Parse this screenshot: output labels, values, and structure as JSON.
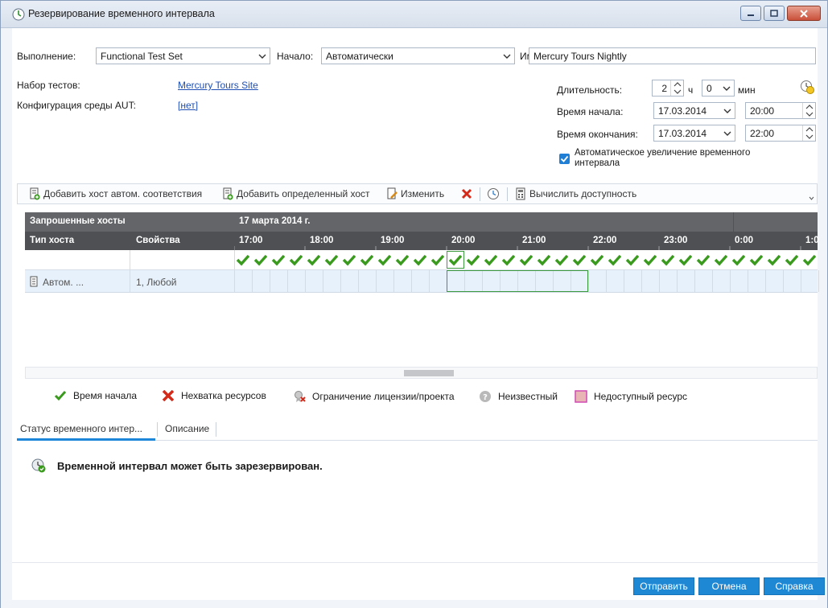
{
  "window": {
    "title": "Резервирование временного интервала"
  },
  "form": {
    "execution_label": "Выполнение:",
    "execution_value": "Functional Test Set",
    "start_label": "Начало:",
    "start_value": "Автоматически",
    "name_label": "Имя:",
    "name_value": "Mercury Tours Nightly",
    "testset_label": "Набор тестов:",
    "testset_value": "Mercury Tours Site",
    "aut_label": "Конфигурация среды AUT:",
    "aut_value": "[нет]",
    "duration_label": "Длительность:",
    "duration_hours": "2",
    "hours_unit": "ч",
    "duration_minutes": "0",
    "minutes_unit": "мин",
    "start_time_label": "Время начала:",
    "start_date": "17.03.2014",
    "start_time": "20:00",
    "end_time_label": "Время окончания:",
    "end_date": "17.03.2014",
    "end_time": "22:00",
    "auto_extend_label": "Автоматическое увеличение временного интервала",
    "auto_extend_checked": true
  },
  "toolbar": {
    "add_auto_host": "Добавить хост автом. соответствия",
    "add_specific_host": "Добавить определенный хост",
    "edit": "Изменить",
    "calc_availability": "Вычислить доступность"
  },
  "grid": {
    "requested_hosts": "Запрошенные хосты",
    "date": "17 марта 2014 г.",
    "col_host_type": "Тип хоста",
    "col_properties": "Свойства",
    "hours": [
      "17:00",
      "18:00",
      "19:00",
      "20:00",
      "21:00",
      "22:00",
      "23:00",
      "0:00",
      "1:0"
    ],
    "host_row": {
      "type": "Автом. ...",
      "properties": "1, Любой"
    }
  },
  "legend": {
    "start_time": "Время начала",
    "lack_resources": "Нехватка ресурсов",
    "license_limit": "Ограничение лицензии/проекта",
    "unknown": "Неизвестный",
    "unavailable": "Недоступный ресурс"
  },
  "tabs": {
    "status": "Статус временного интер...",
    "description": "Описание"
  },
  "status": {
    "message": "Временной интервал может быть зарезервирован."
  },
  "footer": {
    "submit": "Отправить",
    "cancel": "Отмена",
    "help": "Справка"
  },
  "colors": {
    "accent": "#1e88d5",
    "check": "#3a9a1e",
    "header_dark": "#4e5053",
    "header_mid": "#636568",
    "row_highlight": "#e6f1fb",
    "error": "#d42a1a",
    "unavailable": "#e8b4b4"
  }
}
